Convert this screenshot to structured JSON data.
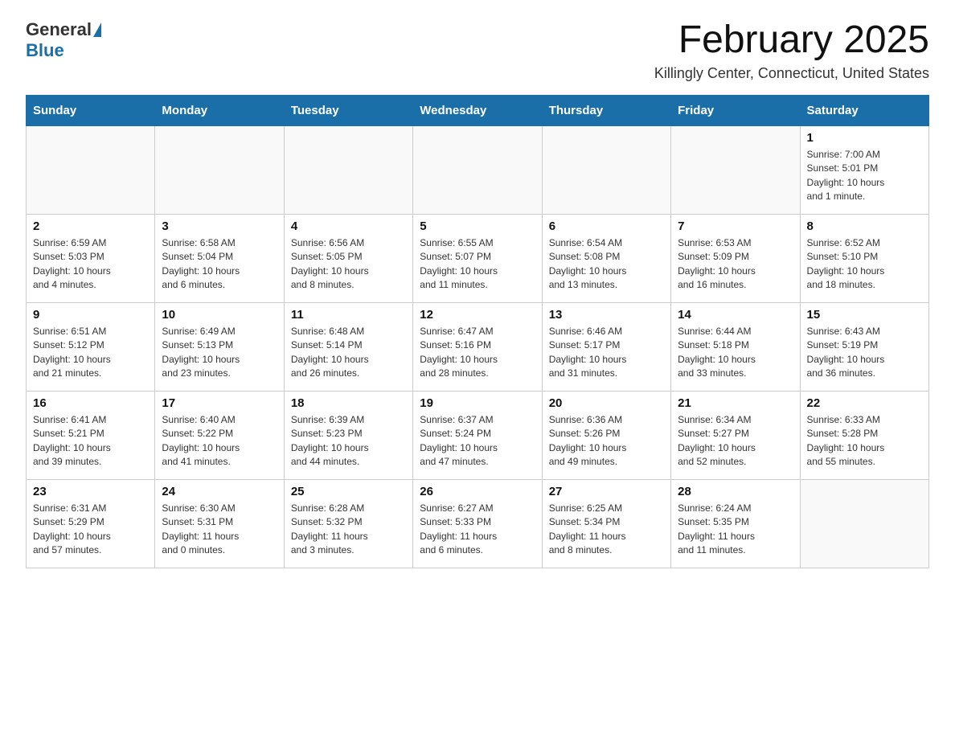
{
  "logo": {
    "general": "General",
    "blue": "Blue"
  },
  "header": {
    "title": "February 2025",
    "location": "Killingly Center, Connecticut, United States"
  },
  "weekdays": [
    "Sunday",
    "Monday",
    "Tuesday",
    "Wednesday",
    "Thursday",
    "Friday",
    "Saturday"
  ],
  "weeks": [
    [
      {
        "day": "",
        "info": ""
      },
      {
        "day": "",
        "info": ""
      },
      {
        "day": "",
        "info": ""
      },
      {
        "day": "",
        "info": ""
      },
      {
        "day": "",
        "info": ""
      },
      {
        "day": "",
        "info": ""
      },
      {
        "day": "1",
        "info": "Sunrise: 7:00 AM\nSunset: 5:01 PM\nDaylight: 10 hours\nand 1 minute."
      }
    ],
    [
      {
        "day": "2",
        "info": "Sunrise: 6:59 AM\nSunset: 5:03 PM\nDaylight: 10 hours\nand 4 minutes."
      },
      {
        "day": "3",
        "info": "Sunrise: 6:58 AM\nSunset: 5:04 PM\nDaylight: 10 hours\nand 6 minutes."
      },
      {
        "day": "4",
        "info": "Sunrise: 6:56 AM\nSunset: 5:05 PM\nDaylight: 10 hours\nand 8 minutes."
      },
      {
        "day": "5",
        "info": "Sunrise: 6:55 AM\nSunset: 5:07 PM\nDaylight: 10 hours\nand 11 minutes."
      },
      {
        "day": "6",
        "info": "Sunrise: 6:54 AM\nSunset: 5:08 PM\nDaylight: 10 hours\nand 13 minutes."
      },
      {
        "day": "7",
        "info": "Sunrise: 6:53 AM\nSunset: 5:09 PM\nDaylight: 10 hours\nand 16 minutes."
      },
      {
        "day": "8",
        "info": "Sunrise: 6:52 AM\nSunset: 5:10 PM\nDaylight: 10 hours\nand 18 minutes."
      }
    ],
    [
      {
        "day": "9",
        "info": "Sunrise: 6:51 AM\nSunset: 5:12 PM\nDaylight: 10 hours\nand 21 minutes."
      },
      {
        "day": "10",
        "info": "Sunrise: 6:49 AM\nSunset: 5:13 PM\nDaylight: 10 hours\nand 23 minutes."
      },
      {
        "day": "11",
        "info": "Sunrise: 6:48 AM\nSunset: 5:14 PM\nDaylight: 10 hours\nand 26 minutes."
      },
      {
        "day": "12",
        "info": "Sunrise: 6:47 AM\nSunset: 5:16 PM\nDaylight: 10 hours\nand 28 minutes."
      },
      {
        "day": "13",
        "info": "Sunrise: 6:46 AM\nSunset: 5:17 PM\nDaylight: 10 hours\nand 31 minutes."
      },
      {
        "day": "14",
        "info": "Sunrise: 6:44 AM\nSunset: 5:18 PM\nDaylight: 10 hours\nand 33 minutes."
      },
      {
        "day": "15",
        "info": "Sunrise: 6:43 AM\nSunset: 5:19 PM\nDaylight: 10 hours\nand 36 minutes."
      }
    ],
    [
      {
        "day": "16",
        "info": "Sunrise: 6:41 AM\nSunset: 5:21 PM\nDaylight: 10 hours\nand 39 minutes."
      },
      {
        "day": "17",
        "info": "Sunrise: 6:40 AM\nSunset: 5:22 PM\nDaylight: 10 hours\nand 41 minutes."
      },
      {
        "day": "18",
        "info": "Sunrise: 6:39 AM\nSunset: 5:23 PM\nDaylight: 10 hours\nand 44 minutes."
      },
      {
        "day": "19",
        "info": "Sunrise: 6:37 AM\nSunset: 5:24 PM\nDaylight: 10 hours\nand 47 minutes."
      },
      {
        "day": "20",
        "info": "Sunrise: 6:36 AM\nSunset: 5:26 PM\nDaylight: 10 hours\nand 49 minutes."
      },
      {
        "day": "21",
        "info": "Sunrise: 6:34 AM\nSunset: 5:27 PM\nDaylight: 10 hours\nand 52 minutes."
      },
      {
        "day": "22",
        "info": "Sunrise: 6:33 AM\nSunset: 5:28 PM\nDaylight: 10 hours\nand 55 minutes."
      }
    ],
    [
      {
        "day": "23",
        "info": "Sunrise: 6:31 AM\nSunset: 5:29 PM\nDaylight: 10 hours\nand 57 minutes."
      },
      {
        "day": "24",
        "info": "Sunrise: 6:30 AM\nSunset: 5:31 PM\nDaylight: 11 hours\nand 0 minutes."
      },
      {
        "day": "25",
        "info": "Sunrise: 6:28 AM\nSunset: 5:32 PM\nDaylight: 11 hours\nand 3 minutes."
      },
      {
        "day": "26",
        "info": "Sunrise: 6:27 AM\nSunset: 5:33 PM\nDaylight: 11 hours\nand 6 minutes."
      },
      {
        "day": "27",
        "info": "Sunrise: 6:25 AM\nSunset: 5:34 PM\nDaylight: 11 hours\nand 8 minutes."
      },
      {
        "day": "28",
        "info": "Sunrise: 6:24 AM\nSunset: 5:35 PM\nDaylight: 11 hours\nand 11 minutes."
      },
      {
        "day": "",
        "info": ""
      }
    ]
  ]
}
